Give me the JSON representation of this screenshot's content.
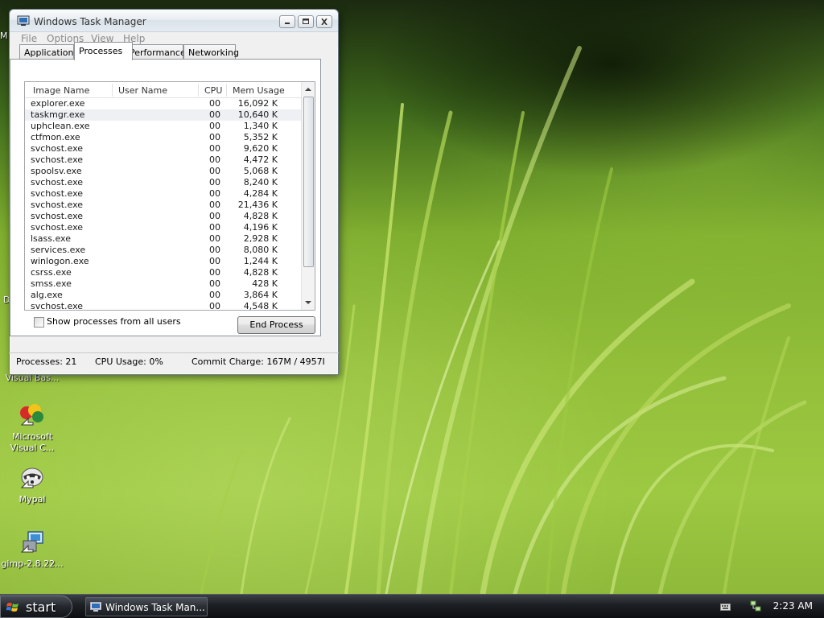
{
  "window": {
    "title": "Windows Task Manager",
    "menu": [
      "File",
      "Options",
      "View",
      "Help"
    ],
    "tabs": [
      "Applications",
      "Processes",
      "Performance",
      "Networking"
    ],
    "active_tab": "Processes",
    "columns": [
      "Image Name",
      "User Name",
      "CPU",
      "Mem Usage"
    ],
    "processes": [
      {
        "name": "explorer.exe",
        "user": "",
        "cpu": "00",
        "mem": "16,092 K"
      },
      {
        "name": "taskmgr.exe",
        "user": "",
        "cpu": "00",
        "mem": "10,640 K"
      },
      {
        "name": "uphclean.exe",
        "user": "",
        "cpu": "00",
        "mem": "1,340 K"
      },
      {
        "name": "ctfmon.exe",
        "user": "",
        "cpu": "00",
        "mem": "5,352 K"
      },
      {
        "name": "svchost.exe",
        "user": "",
        "cpu": "00",
        "mem": "9,620 K"
      },
      {
        "name": "svchost.exe",
        "user": "",
        "cpu": "00",
        "mem": "4,472 K"
      },
      {
        "name": "spoolsv.exe",
        "user": "",
        "cpu": "00",
        "mem": "5,068 K"
      },
      {
        "name": "svchost.exe",
        "user": "",
        "cpu": "00",
        "mem": "8,240 K"
      },
      {
        "name": "svchost.exe",
        "user": "",
        "cpu": "00",
        "mem": "4,284 K"
      },
      {
        "name": "svchost.exe",
        "user": "",
        "cpu": "00",
        "mem": "21,436 K"
      },
      {
        "name": "svchost.exe",
        "user": "",
        "cpu": "00",
        "mem": "4,828 K"
      },
      {
        "name": "svchost.exe",
        "user": "",
        "cpu": "00",
        "mem": "4,196 K"
      },
      {
        "name": "lsass.exe",
        "user": "",
        "cpu": "00",
        "mem": "2,928 K"
      },
      {
        "name": "services.exe",
        "user": "",
        "cpu": "00",
        "mem": "8,080 K"
      },
      {
        "name": "winlogon.exe",
        "user": "",
        "cpu": "00",
        "mem": "1,244 K"
      },
      {
        "name": "csrss.exe",
        "user": "",
        "cpu": "00",
        "mem": "4,828 K"
      },
      {
        "name": "smss.exe",
        "user": "",
        "cpu": "00",
        "mem": "428 K"
      },
      {
        "name": "alg.exe",
        "user": "",
        "cpu": "00",
        "mem": "3,864 K"
      },
      {
        "name": "svchost.exe",
        "user": "",
        "cpu": "00",
        "mem": "4,548 K"
      }
    ],
    "selected_process": "taskmgr.exe",
    "show_all_label": "Show processes from all users",
    "show_all_checked": false,
    "end_process_label": "End Process",
    "status": {
      "processes": "Processes: 21",
      "cpu": "CPU Usage: 0%",
      "commit": "Commit Charge: 167M / 4957I"
    }
  },
  "desktop": {
    "icons": [
      {
        "label": "Visual Bas...",
        "icon": "visual-basic-icon"
      },
      {
        "label": "Microsoft Visual C...",
        "icon": "visual-c-icon"
      },
      {
        "label": "Mypal",
        "icon": "mypal-raccoon-icon"
      },
      {
        "label": "gimp-2.8.22...",
        "icon": "gimp-installer-icon"
      }
    ],
    "partial_labels": [
      "M",
      "D"
    ]
  },
  "taskbar": {
    "start_label": "start",
    "task_button_label": "Windows Task Man...",
    "clock": "2:23 AM"
  }
}
